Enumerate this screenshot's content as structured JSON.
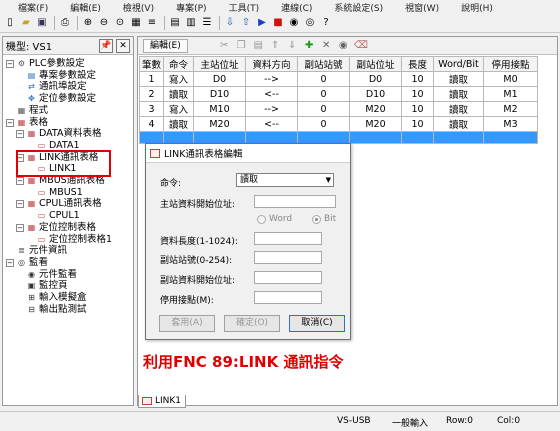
{
  "menu": [
    "檔案(F)",
    "編輯(E)",
    "檢視(V)",
    "專案(P)",
    "工具(T)",
    "連線(C)",
    "系統設定(S)",
    "視窗(W)",
    "說明(H)"
  ],
  "left_panel": {
    "title": "機型: VS1",
    "tree": [
      {
        "label": "PLC參數設定",
        "level": 0,
        "icon": "gear-icon"
      },
      {
        "label": "專案參數設定",
        "level": 1,
        "icon": "doc-icon"
      },
      {
        "label": "通訊埠設定",
        "level": 1,
        "icon": "port-icon"
      },
      {
        "label": "定位參數設定",
        "level": 1,
        "icon": "position-icon"
      },
      {
        "label": "程式",
        "level": 0,
        "icon": "program-icon"
      },
      {
        "label": "表格",
        "level": 0,
        "icon": "table-icon"
      },
      {
        "label": "DATA資料表格",
        "level": 1,
        "icon": "table-icon"
      },
      {
        "label": "DATA1",
        "level": 2,
        "icon": "sheet-icon"
      },
      {
        "label": "LINK通訊表格",
        "level": 1,
        "icon": "table-icon"
      },
      {
        "label": "LINK1",
        "level": 2,
        "icon": "sheet-icon"
      },
      {
        "label": "MBUS通訊表格",
        "level": 1,
        "icon": "table-icon"
      },
      {
        "label": "MBUS1",
        "level": 2,
        "icon": "sheet-icon"
      },
      {
        "label": "CPUL通訊表格",
        "level": 1,
        "icon": "table-icon"
      },
      {
        "label": "CPUL1",
        "level": 2,
        "icon": "sheet-icon"
      },
      {
        "label": "定位控制表格",
        "level": 1,
        "icon": "table-icon"
      },
      {
        "label": "定位控制表格1",
        "level": 2,
        "icon": "sheet-icon"
      },
      {
        "label": "元件資訊",
        "level": 0,
        "icon": "info-icon"
      },
      {
        "label": "監看",
        "level": 0,
        "icon": "monitor-icon"
      },
      {
        "label": "元件監看",
        "level": 1,
        "icon": "eye-icon"
      },
      {
        "label": "監控頁",
        "level": 1,
        "icon": "page-icon"
      },
      {
        "label": "輸入模擬盒",
        "level": 1,
        "icon": "input-icon"
      },
      {
        "label": "輸出點測試",
        "level": 1,
        "icon": "output-icon"
      }
    ]
  },
  "editor": {
    "edit_tab": "編輯(E)",
    "columns": [
      "筆數",
      "命令",
      "主站位址",
      "資料方向",
      "副站站號",
      "副站位址",
      "長度",
      "Word/Bit",
      "停用接點"
    ],
    "rows": [
      [
        "1",
        "寫入",
        "D0",
        "-->",
        "0",
        "D0",
        "10",
        "讀取",
        "M0"
      ],
      [
        "2",
        "讀取",
        "D10",
        "<--",
        "0",
        "D10",
        "10",
        "讀取",
        "M1"
      ],
      [
        "3",
        "寫入",
        "M10",
        "-->",
        "0",
        "M20",
        "10",
        "讀取",
        "M2"
      ],
      [
        "4",
        "讀取",
        "M20",
        "<--",
        "0",
        "M20",
        "10",
        "讀取",
        "M3"
      ]
    ]
  },
  "dialog": {
    "title": "LINK通訊表格編輯",
    "command_label": "命令:",
    "command_value": "讀取",
    "master_addr_label": "主站資料開始位址:",
    "word_label": "Word",
    "bit_label": "Bit",
    "length_label": "資料長度(1-1024):",
    "slave_no_label": "副站站號(0-254):",
    "slave_addr_label": "副站資料開始位址:",
    "disable_label": "停用接點(M):",
    "apply_button": "套用(A)",
    "ok_button": "確定(O)",
    "cancel_button": "取消(C)"
  },
  "caption": "利用FNC 89:LINK 通訊指令",
  "bottom_tab": "LINK1",
  "status": {
    "connection": "VS-USB",
    "mode": "一般輸入",
    "row": "Row:0",
    "col": "Col:0"
  }
}
